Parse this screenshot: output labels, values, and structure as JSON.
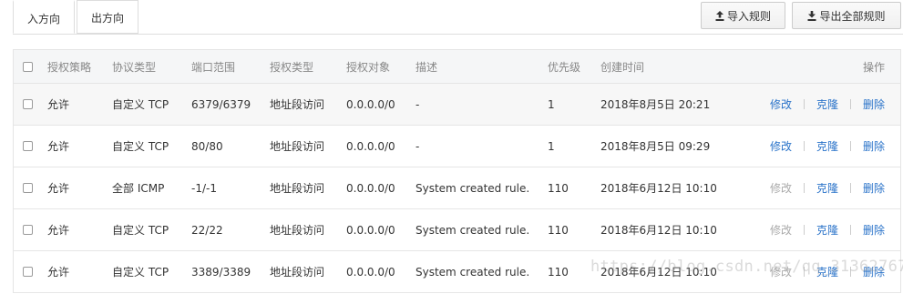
{
  "tabs": [
    {
      "label": "入方向",
      "active": true
    },
    {
      "label": "出方向",
      "active": false
    }
  ],
  "toolbar": {
    "import_label": "导入规则",
    "import_icon": "upload-icon",
    "export_label": "导出全部规则",
    "export_icon": "download-icon"
  },
  "table": {
    "headers": {
      "policy": "授权策略",
      "protocol": "协议类型",
      "port": "端口范围",
      "auth_type": "授权类型",
      "target": "授权对象",
      "description": "描述",
      "priority": "优先级",
      "created": "创建时间",
      "actions": "操作"
    },
    "rows": [
      {
        "policy": "允许",
        "protocol": "自定义 TCP",
        "port": "6379/6379",
        "auth_type": "地址段访问",
        "target": "0.0.0.0/0",
        "description": "-",
        "priority": "1",
        "created": "2018年8月5日 20:21",
        "edit": "修改",
        "clone": "克隆",
        "delete": "删除",
        "edit_enabled": true
      },
      {
        "policy": "允许",
        "protocol": "自定义 TCP",
        "port": "80/80",
        "auth_type": "地址段访问",
        "target": "0.0.0.0/0",
        "description": "-",
        "priority": "1",
        "created": "2018年8月5日 09:29",
        "edit": "修改",
        "clone": "克隆",
        "delete": "删除",
        "edit_enabled": true
      },
      {
        "policy": "允许",
        "protocol": "全部 ICMP",
        "port": "-1/-1",
        "auth_type": "地址段访问",
        "target": "0.0.0.0/0",
        "description": "System created rule.",
        "priority": "110",
        "created": "2018年6月12日 10:10",
        "edit": "修改",
        "clone": "克隆",
        "delete": "删除",
        "edit_enabled": false
      },
      {
        "policy": "允许",
        "protocol": "自定义 TCP",
        "port": "22/22",
        "auth_type": "地址段访问",
        "target": "0.0.0.0/0",
        "description": "System created rule.",
        "priority": "110",
        "created": "2018年6月12日 10:10",
        "edit": "修改",
        "clone": "克隆",
        "delete": "删除",
        "edit_enabled": false
      },
      {
        "policy": "允许",
        "protocol": "自定义 TCP",
        "port": "3389/3389",
        "auth_type": "地址段访问",
        "target": "0.0.0.0/0",
        "description": "System created rule.",
        "priority": "110",
        "created": "2018年6月12日 10:10",
        "edit": "修改",
        "clone": "克隆",
        "delete": "删除",
        "edit_enabled": false
      }
    ]
  },
  "watermark": "https://blog.csdn.net/qq_31362767",
  "colors": {
    "link": "#2a73c9",
    "disabled_link": "#aaaaaa",
    "header_bg": "#f5f6f7"
  }
}
